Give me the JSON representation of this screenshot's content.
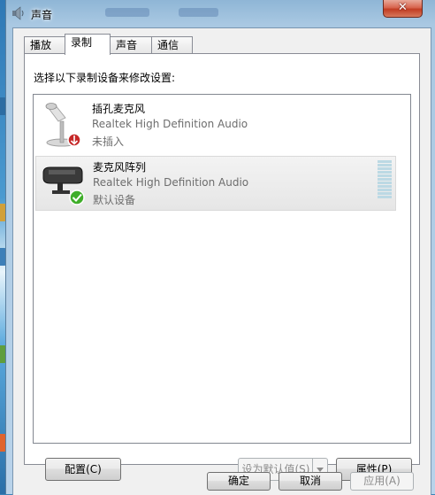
{
  "window": {
    "title": "声音",
    "close_glyph": "✕"
  },
  "tabs": [
    {
      "label": "播放"
    },
    {
      "label": "录制"
    },
    {
      "label": "声音"
    },
    {
      "label": "通信"
    }
  ],
  "active_tab": "录制",
  "instructions": "选择以下录制设备来修改设置:",
  "devices": [
    {
      "name": "插孔麦克风",
      "driver": "Realtek High Definition Audio",
      "status": "未插入",
      "icon": "microphone-icon",
      "badge": "unplugged-down-arrow-icon"
    },
    {
      "name": "麦克风阵列",
      "driver": "Realtek High Definition Audio",
      "status": "默认设备",
      "icon": "microphone-array-icon",
      "badge": "default-checkmark-icon",
      "selected": true
    }
  ],
  "buttons": {
    "configure": "配置(C)",
    "set_default": "设为默认值(S)",
    "properties": "属性(P)",
    "ok": "确定",
    "cancel": "取消",
    "apply": "应用(A)"
  },
  "colors": {
    "checkmark": "#3fae2a",
    "unplugged_badge": "#c62828",
    "level_meter": "#bcd9e4"
  }
}
